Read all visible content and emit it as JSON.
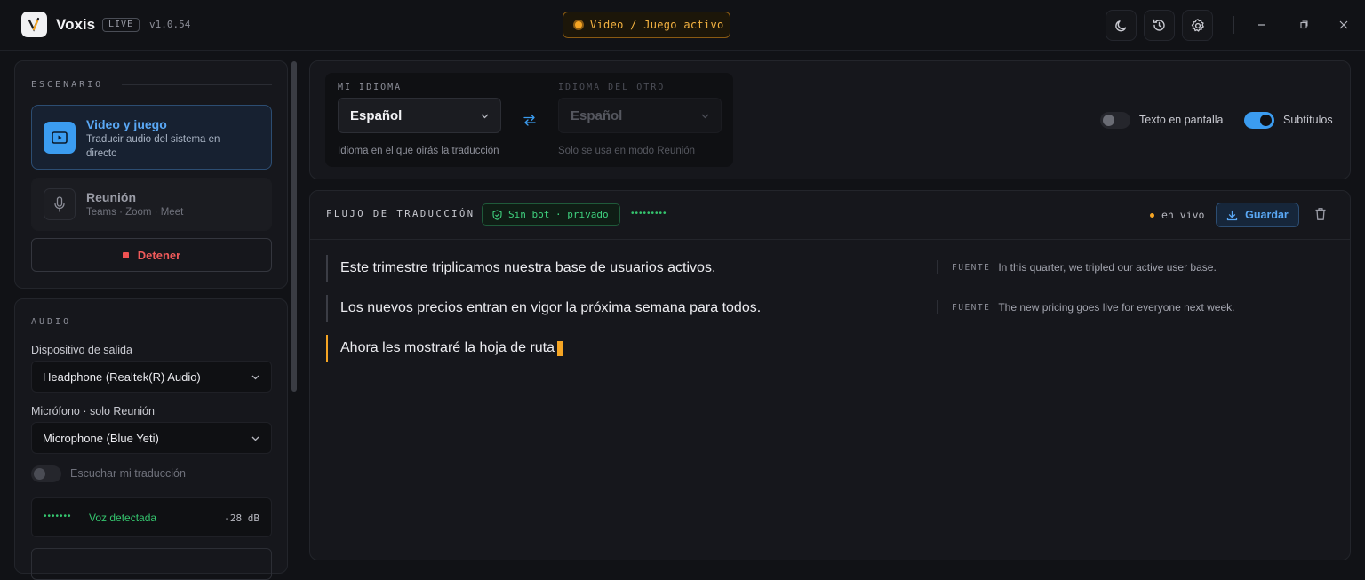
{
  "app": {
    "name": "Voxis",
    "badge": "LIVE",
    "version": "v1.0.54"
  },
  "mode_pill": {
    "label": "Video / Juego activo"
  },
  "titlebar_icons": [
    "moon-icon",
    "history-icon",
    "gear-icon"
  ],
  "scenario": {
    "title": "ESCENARIO",
    "options": [
      {
        "title": "Video y juego",
        "subtitle_line1": "Traducir audio del sistema en",
        "subtitle_line2": "directo",
        "active": true,
        "icon": "monitor-icon"
      },
      {
        "title": "Reunión",
        "subtitle": "Teams · Zoom · Meet",
        "active": false,
        "icon": "microphone-icon"
      }
    ],
    "stop_label": "Detener"
  },
  "audio": {
    "title": "AUDIO",
    "output_label": "Dispositivo de salida",
    "output_value": "Headphone (Realtek(R) Audio)",
    "mic_label": "Micrófono · solo Reunión",
    "mic_value": "Microphone (Blue Yeti)",
    "listen_label": "Escuchar mi traducción",
    "listen_on": false,
    "vu_dots": "•••••••",
    "voice_status": "Voz detectada",
    "level": "-28 dB"
  },
  "languages": {
    "mine_label": "MI IDIOMA",
    "mine_value": "Español",
    "mine_hint": "Idioma en el que oirás la traducción",
    "other_label": "IDIOMA DEL OTRO",
    "other_value": "Español",
    "other_hint": "Solo se usa en modo Reunión"
  },
  "toggles": {
    "screen_text": {
      "label": "Texto en pantalla",
      "on": false
    },
    "subtitles": {
      "label": "Subtítulos",
      "on": true
    }
  },
  "flow": {
    "title": "FLUJO DE TRADUCCIÓN",
    "badge": "Sin bot · privado",
    "dots": "•••••••••",
    "live_label": "en vivo",
    "save_label": "Guardar",
    "source_label": "FUENTE",
    "lines": [
      {
        "text": "Este trimestre triplicamos nuestra base de usuarios activos.",
        "source": "In this quarter, we tripled our active user base."
      },
      {
        "text": "Los nuevos precios entran en vigor la próxima semana para todos.",
        "source": "The new pricing goes live for everyone next week."
      },
      {
        "text": "Ahora les mostraré la hoja de ruta",
        "source": ""
      }
    ]
  },
  "colors": {
    "accent_blue": "#3b9cf0",
    "accent_amber": "#f5a524",
    "danger": "#f05252",
    "success": "#35c46e"
  }
}
